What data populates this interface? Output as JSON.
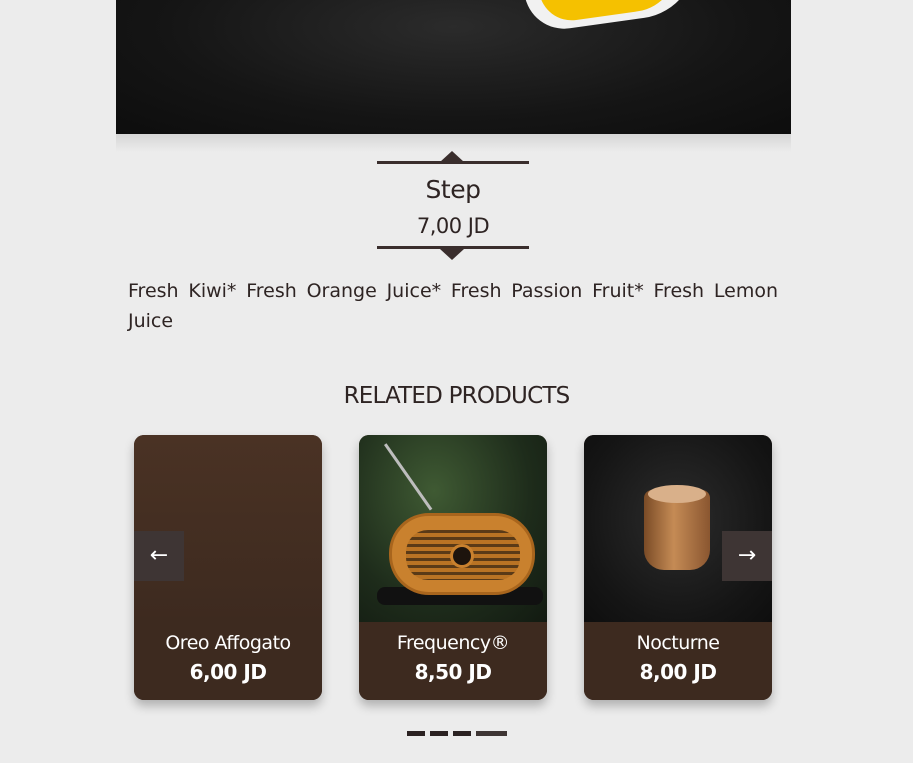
{
  "product": {
    "name": "Step",
    "price": "7,00 JD",
    "description": "Fresh Kiwi* Fresh Orange Juice* Fresh Passion Fruit* Fresh Lemon Juice"
  },
  "related": {
    "title": "RELATED PRODUCTS",
    "items": [
      {
        "name": "Oreo Affogato",
        "price": "6,00 JD"
      },
      {
        "name": "Frequency®",
        "price": "8,50 JD"
      },
      {
        "name": "Nocturne",
        "price": "8,00 JD"
      }
    ],
    "prev_icon": "arrow-left-icon",
    "next_icon": "arrow-right-icon",
    "pagination": {
      "count": 4,
      "active_index": 3
    }
  },
  "colors": {
    "page_background": "#ececec",
    "text": "#2e2423",
    "card_caption": "#3d2a1f",
    "nav_button": "#3e3534"
  }
}
